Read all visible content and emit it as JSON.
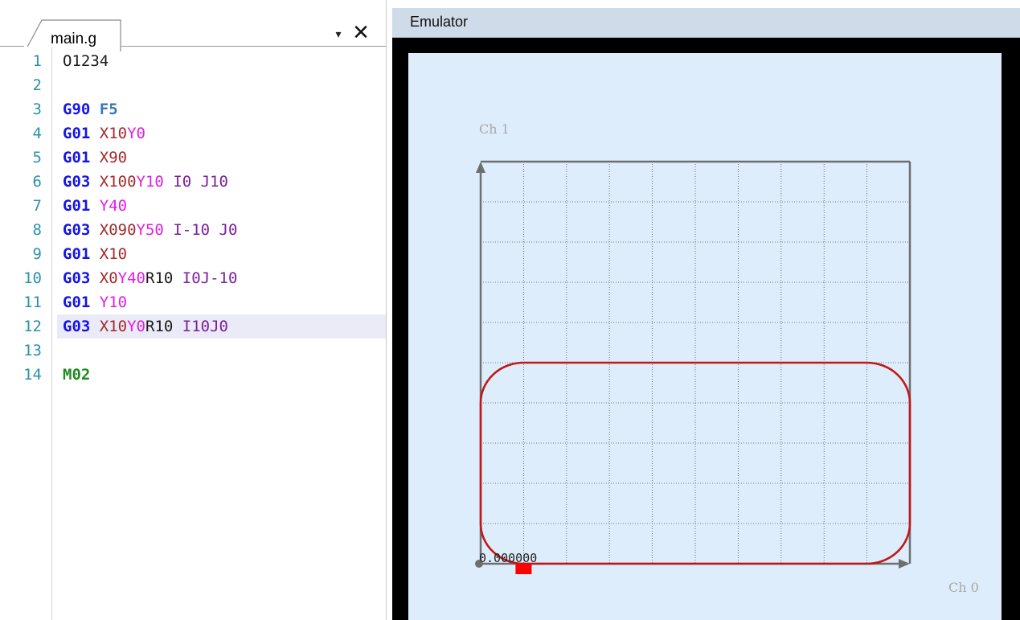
{
  "editor": {
    "tab_label": "main.g",
    "dropdown_icon": "▾",
    "close_icon": "✕",
    "lines": [
      {
        "num": "1",
        "tokens": [
          {
            "t": "O1234",
            "c": "plain"
          }
        ]
      },
      {
        "num": "2",
        "tokens": []
      },
      {
        "num": "3",
        "tokens": [
          {
            "t": "G90",
            "c": "gcode"
          },
          {
            "t": " ",
            "c": "plain"
          },
          {
            "t": "F5",
            "c": "fword"
          }
        ]
      },
      {
        "num": "4",
        "tokens": [
          {
            "t": "G01",
            "c": "gcode"
          },
          {
            "t": " ",
            "c": "plain"
          },
          {
            "t": "X10",
            "c": "xword"
          },
          {
            "t": "Y0",
            "c": "yword"
          }
        ]
      },
      {
        "num": "5",
        "tokens": [
          {
            "t": "G01",
            "c": "gcode"
          },
          {
            "t": " ",
            "c": "plain"
          },
          {
            "t": "X90",
            "c": "xword"
          }
        ]
      },
      {
        "num": "6",
        "tokens": [
          {
            "t": "G03",
            "c": "gcode"
          },
          {
            "t": " ",
            "c": "plain"
          },
          {
            "t": "X100",
            "c": "xword"
          },
          {
            "t": "Y10",
            "c": "yword"
          },
          {
            "t": " I0 J10",
            "c": "ijword"
          }
        ]
      },
      {
        "num": "7",
        "tokens": [
          {
            "t": "G01",
            "c": "gcode"
          },
          {
            "t": " ",
            "c": "plain"
          },
          {
            "t": "Y40",
            "c": "yword"
          }
        ]
      },
      {
        "num": "8",
        "tokens": [
          {
            "t": "G03",
            "c": "gcode"
          },
          {
            "t": " ",
            "c": "plain"
          },
          {
            "t": "X090",
            "c": "xword"
          },
          {
            "t": "Y50",
            "c": "yword"
          },
          {
            "t": " I-10 J0",
            "c": "ijword"
          }
        ]
      },
      {
        "num": "9",
        "tokens": [
          {
            "t": "G01",
            "c": "gcode"
          },
          {
            "t": " ",
            "c": "plain"
          },
          {
            "t": "X10",
            "c": "xword"
          }
        ]
      },
      {
        "num": "10",
        "tokens": [
          {
            "t": "G03",
            "c": "gcode"
          },
          {
            "t": " ",
            "c": "plain"
          },
          {
            "t": "X0",
            "c": "xword"
          },
          {
            "t": "Y40",
            "c": "yword"
          },
          {
            "t": "R10",
            "c": "rword"
          },
          {
            "t": " I0J-10",
            "c": "ijword"
          }
        ]
      },
      {
        "num": "11",
        "tokens": [
          {
            "t": "G01",
            "c": "gcode"
          },
          {
            "t": " ",
            "c": "plain"
          },
          {
            "t": "Y10",
            "c": "yword"
          }
        ]
      },
      {
        "num": "12",
        "tokens": [
          {
            "t": "G03",
            "c": "gcode"
          },
          {
            "t": " ",
            "c": "plain"
          },
          {
            "t": "X10",
            "c": "xword"
          },
          {
            "t": "Y0",
            "c": "yword"
          },
          {
            "t": "R10",
            "c": "rword"
          },
          {
            "t": " I10J0",
            "c": "ijword"
          }
        ],
        "active": true
      },
      {
        "num": "13",
        "tokens": []
      },
      {
        "num": "14",
        "tokens": [
          {
            "t": "M02",
            "c": "mcode"
          }
        ]
      }
    ]
  },
  "emulator": {
    "title": "Emulator",
    "y_channel_label": "Ch 1",
    "x_channel_label": "Ch 0",
    "origin_readout": "0.000000",
    "colors": {
      "background": "#deedfb",
      "grid": "#555555",
      "axis": "#6e6e6e",
      "path": "#c01818",
      "marker": "#ff0000",
      "label": "#a8a8a8"
    },
    "plot": {
      "x_range": [
        0,
        100
      ],
      "y_range": [
        0,
        100
      ],
      "grid_divisions": 10,
      "toolpath": [
        {
          "type": "line",
          "from": [
            10,
            0
          ],
          "to": [
            90,
            0
          ]
        },
        {
          "type": "arc_ccw",
          "from": [
            90,
            0
          ],
          "to": [
            100,
            10
          ],
          "center": [
            90,
            10
          ]
        },
        {
          "type": "line",
          "from": [
            100,
            10
          ],
          "to": [
            100,
            40
          ]
        },
        {
          "type": "arc_ccw",
          "from": [
            100,
            40
          ],
          "to": [
            90,
            50
          ],
          "center": [
            90,
            40
          ]
        },
        {
          "type": "line",
          "from": [
            90,
            50
          ],
          "to": [
            10,
            50
          ]
        },
        {
          "type": "arc_ccw",
          "from": [
            10,
            50
          ],
          "to": [
            0,
            40
          ],
          "center": [
            10,
            40
          ]
        },
        {
          "type": "line",
          "from": [
            0,
            40
          ],
          "to": [
            0,
            10
          ]
        },
        {
          "type": "arc_ccw",
          "from": [
            0,
            10
          ],
          "to": [
            10,
            0
          ],
          "center": [
            10,
            10
          ]
        }
      ],
      "tool_position": [
        10,
        0
      ]
    }
  }
}
